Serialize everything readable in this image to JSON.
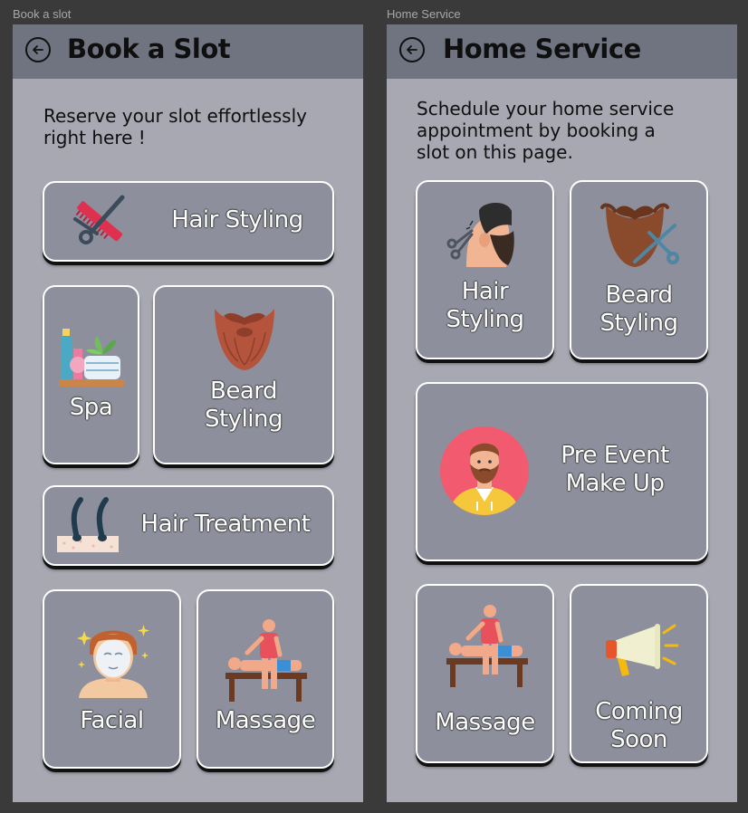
{
  "frames": [
    {
      "label": "Book a slot",
      "title": "Book a Slot",
      "subtitle": "Reserve your slot effortlessly\nright here !",
      "cards": {
        "hair_styling": "Hair Styling",
        "spa": "Spa",
        "beard_styling": "Beard\nStyling",
        "hair_treatment": "Hair Treatment",
        "facial": "Facial",
        "massage": "Massage"
      },
      "icons": {
        "hair_styling": "scissors-comb-icon",
        "spa": "spa-products-icon",
        "beard_styling": "beard-icon",
        "hair_treatment": "hair-follicle-icon",
        "facial": "face-mask-icon",
        "massage": "massage-icon"
      }
    },
    {
      "label": "Home Service",
      "title": "Home Service",
      "subtitle": "Schedule your home service\nappointment by booking a\nslot on this page.",
      "cards": {
        "hair_styling": "Hair\nStyling",
        "beard_styling": "Beard\nStyling",
        "pre_event_makeup": "Pre Event\nMake Up",
        "massage": "Massage",
        "coming_soon": "Coming\nSoon"
      },
      "icons": {
        "hair_styling": "barber-haircut-icon",
        "beard_styling": "beard-scissors-icon",
        "pre_event_makeup": "man-avatar-icon",
        "massage": "massage-icon",
        "coming_soon": "megaphone-icon"
      }
    }
  ],
  "colors": {
    "background": "#3a3a3a",
    "frame": "#a8a8b3",
    "appbar": "#6f7480",
    "card": "#8d909c",
    "card_border": "#ffffff"
  }
}
